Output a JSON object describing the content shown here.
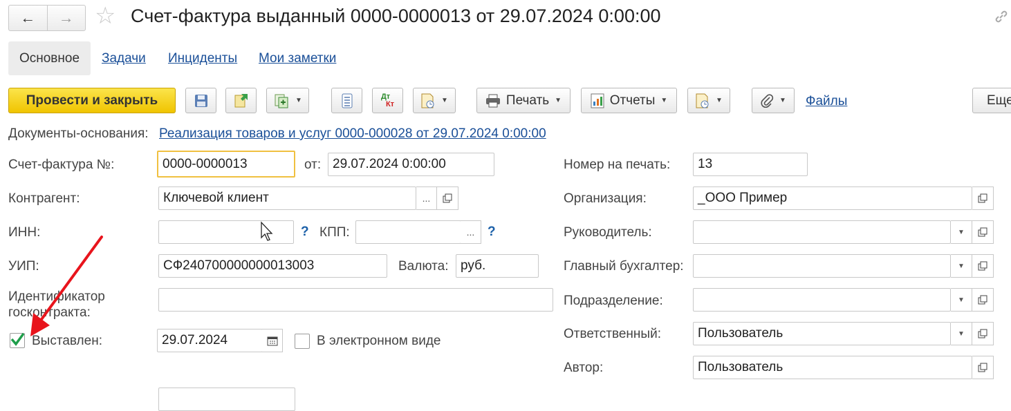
{
  "window": {
    "title": "Счет-фактура выданный 0000-0000013 от 29.07.2024 0:00:00",
    "back_icon": "arrow-left-icon",
    "forward_icon": "arrow-right-icon",
    "favorite_icon": "star-icon",
    "link_icon": "link-icon"
  },
  "tabs": [
    {
      "label": "Основное",
      "active": true
    },
    {
      "label": "Задачи"
    },
    {
      "label": "Инциденты"
    },
    {
      "label": "Мои заметки"
    }
  ],
  "toolbar": {
    "post_close": "Провести и закрыть",
    "print": "Печать",
    "reports": "Отчеты",
    "files": "Файлы",
    "more": "Еще",
    "dtkt_top": "Дт",
    "dtkt_bottom": "Кт"
  },
  "form": {
    "base_docs_label": "Документы-основания:",
    "base_docs_link": "Реализация товаров и услуг 0000-000028 от 29.07.2024 0:00:00",
    "invoice_no_label": "Счет-фактура №:",
    "invoice_no": "0000-0000013",
    "from_label": "от:",
    "from_value": "29.07.2024  0:00:00",
    "counterparty_label": "Контрагент:",
    "counterparty": "Ключевой клиент",
    "inn_label": "ИНН:",
    "inn": "",
    "kpp_label": "КПП:",
    "kpp": "",
    "question": "?",
    "ellipsis": "...",
    "uip_label": "УИП:",
    "uip": "СФ240700000000013003",
    "currency_label": "Валюта:",
    "currency": "руб.",
    "gov_contract_label_1": "Идентификатор",
    "gov_contract_label_2": "госконтракта:",
    "gov_contract": "",
    "issued_label": "Выставлен:",
    "issued_checked": true,
    "issued_date": "29.07.2024",
    "electronic_label": "В электронном виде",
    "electronic_checked": false,
    "print_no_label": "Номер на печать:",
    "print_no": "13",
    "org_label": "Организация:",
    "org": "_ООО Пример",
    "head_label": "Руководитель:",
    "head": "",
    "chief_acc_label": "Главный бухгалтер:",
    "chief_acc": "",
    "division_label": "Подразделение:",
    "division": "",
    "responsible_label": "Ответственный:",
    "responsible": "Пользователь",
    "author_label": "Автор:",
    "author": "Пользователь"
  },
  "colors": {
    "primary_button": "#f3cd14",
    "link": "#1a4f98",
    "focus_border": "#f0c040",
    "check": "#1e9e4a",
    "annotation_arrow": "#e8141c"
  }
}
